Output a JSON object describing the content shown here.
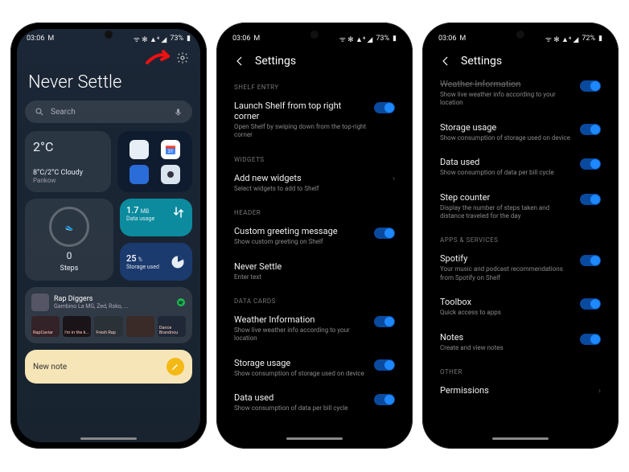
{
  "statusbar": {
    "time_a": "03:06",
    "time_b": "03:06",
    "time_c": "03:06",
    "battery": "73%",
    "battery_c": "72%",
    "icons": "⋯ ⋯"
  },
  "shelf": {
    "header": "Never Settle",
    "search_placeholder": "Search",
    "weather": {
      "temp": "2°C",
      "cond": "8°C/2°C Cloudy",
      "loc": "Pankow"
    },
    "steps": {
      "count": "0",
      "label": "Steps"
    },
    "data": {
      "value": "1.7",
      "unit": "MB",
      "label": "Data usage"
    },
    "storage": {
      "value": "25",
      "unit": "%",
      "label": "Storage used"
    },
    "spotify": {
      "title": "Rap Diggers",
      "artists": "Gambino La MG, Zed, Rsko, ...",
      "thumbs": [
        "RapCaviar",
        "I'm in the k...",
        "Fresh Rap",
        "",
        "Dance Brandnou"
      ]
    },
    "note": "New note"
  },
  "settings_title": "Settings",
  "panel2": {
    "sections": {
      "shelf_entry": "SHELF ENTRY",
      "widgets": "WIDGETS",
      "header": "HEADER",
      "data_cards": "DATA CARDS"
    },
    "items": {
      "launch": {
        "label": "Launch Shelf from top right corner",
        "sub": "Open Shelf by swiping down from the top-right corner"
      },
      "add_widgets": {
        "label": "Add new widgets",
        "sub": "Select widgets to add to Shelf"
      },
      "greeting": {
        "label": "Custom greeting message",
        "sub": "Show custom greeting on Shelf"
      },
      "never_settle": {
        "label": "Never Settle",
        "sub": "Enter text"
      },
      "weather": {
        "label": "Weather Information",
        "sub": "Show live weather info according to your location"
      },
      "storage": {
        "label": "Storage usage",
        "sub": "Show consumption of storage used on device"
      },
      "data": {
        "label": "Data used",
        "sub": "Show consumption of data per bill cycle"
      }
    }
  },
  "panel3": {
    "sections": {
      "apps": "APPS & SERVICES",
      "other": "OTHER"
    },
    "items": {
      "weather_tail": {
        "label": "Weather Information",
        "sub": "Show live weather info according to your location"
      },
      "storage": {
        "label": "Storage usage",
        "sub": "Show consumption of storage used on device"
      },
      "data": {
        "label": "Data used",
        "sub": "Show consumption of data per bill cycle"
      },
      "steps": {
        "label": "Step counter",
        "sub": "Display the number of steps taken and distance traveled for the day"
      },
      "spotify": {
        "label": "Spotify",
        "sub": "Your music and podcast recommendations from Spotify on Shelf"
      },
      "toolbox": {
        "label": "Toolbox",
        "sub": "Quick access to apps"
      },
      "notes": {
        "label": "Notes",
        "sub": "Create and view notes"
      },
      "permissions": {
        "label": "Permissions"
      }
    }
  }
}
